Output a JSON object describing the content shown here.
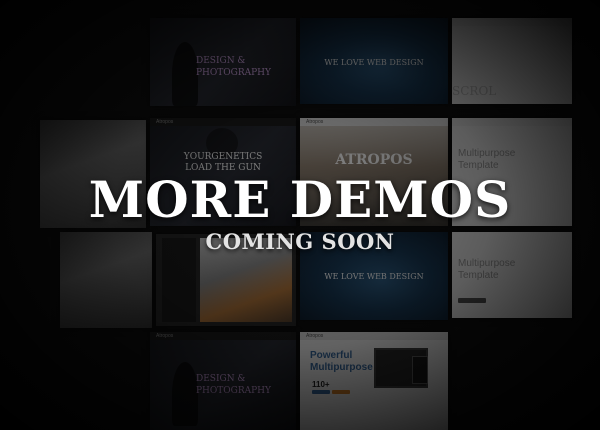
{
  "overlay": {
    "headline": "MORE DEMOS",
    "subline": "COMING SOON"
  },
  "thumbnails": {
    "t1": {
      "line1": "DESIGN &",
      "line2": "PHOTOGRAPHY"
    },
    "t2": {
      "line1": "WE LOVE WEB DESIGN"
    },
    "t3": {
      "line1": "SCROL"
    },
    "t4": {
      "brand": "Atropos",
      "line1": "YOURGENETICS",
      "line2": "LOAD THE GUN"
    },
    "t5": {
      "brand": "Atropos",
      "line1": "ATROPOS"
    },
    "t6": {
      "line1": "Multipurpose",
      "line2": "Template"
    },
    "t7": {
      "line1": "WE LOVE WEB DESIGN"
    },
    "t8": {
      "line1": "Multipurpose",
      "line2": "Template"
    },
    "t9": {
      "brand": "Atropos",
      "line1": "DESIGN &",
      "line2": "PHOTOGRAPHY"
    },
    "t10": {
      "brand": "Atropos",
      "line1": "Powerful",
      "line2": "Multipurpose",
      "stat": "110+"
    }
  },
  "colors": {
    "background": "#111111",
    "accent_blue": "#3a6fa8",
    "accent_orange": "#e58a2c",
    "text_white": "#ffffff"
  }
}
